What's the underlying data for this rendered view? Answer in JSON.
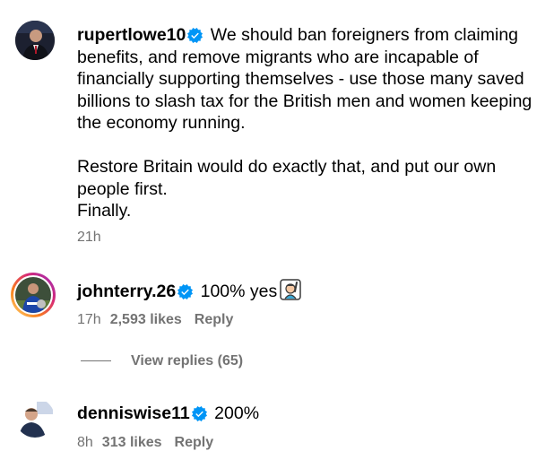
{
  "comments": [
    {
      "username": "rupertlowe10",
      "verified": true,
      "paragraphs": [
        "We should ban foreigners from claiming benefits, and remove migrants who are incapable of financially supporting themselves - use those many saved billions to slash tax for the British men and women keeping the economy running.",
        "Restore Britain would do exactly that, and put our own people first.",
        "Finally."
      ],
      "time": "21h"
    },
    {
      "username": "johnterry.26",
      "verified": true,
      "text": "100% yes",
      "emoji": "raising-hand-emoji",
      "time": "17h",
      "likes": "2,593 likes",
      "reply_label": "Reply"
    },
    {
      "username": "denniswise11",
      "verified": true,
      "text": "200%",
      "time": "8h",
      "likes": "313 likes",
      "reply_label": "Reply"
    }
  ],
  "view_replies": "View replies (65)",
  "colors": {
    "verified": "#0095f6",
    "secondary": "#737373",
    "story_ring": "#d62976"
  },
  "icons": [
    "verified-badge-icon",
    "raising-hand-emoji"
  ]
}
